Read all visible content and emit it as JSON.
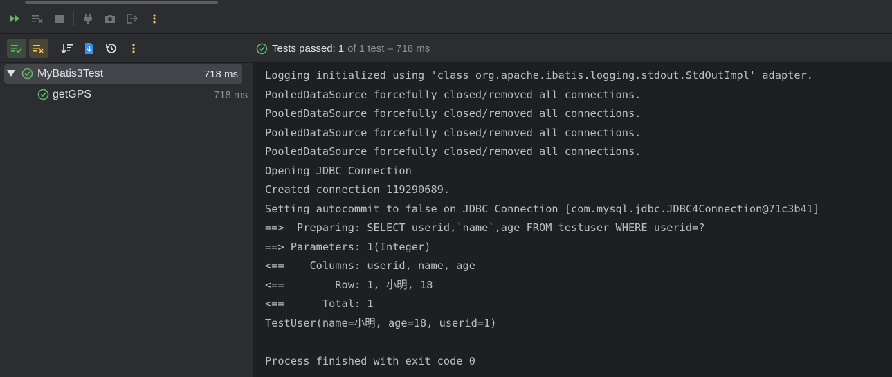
{
  "toolbar": {
    "rerun_label": "Rerun",
    "more_label": "More"
  },
  "status": {
    "passed_label": "Tests passed:",
    "passed_count": "1",
    "rest": "of 1 test – 718 ms"
  },
  "tree": {
    "items": [
      {
        "label": "MyBatis3Test",
        "time": "718 ms"
      },
      {
        "label": "getGPS",
        "time": "718 ms"
      }
    ]
  },
  "console": {
    "lines": [
      "Logging initialized using 'class org.apache.ibatis.logging.stdout.StdOutImpl' adapter.",
      "PooledDataSource forcefully closed/removed all connections.",
      "PooledDataSource forcefully closed/removed all connections.",
      "PooledDataSource forcefully closed/removed all connections.",
      "PooledDataSource forcefully closed/removed all connections.",
      "Opening JDBC Connection",
      "Created connection 119290689.",
      "Setting autocommit to false on JDBC Connection [com.mysql.jdbc.JDBC4Connection@71c3b41]",
      "==>  Preparing: SELECT userid,`name`,age FROM testuser WHERE userid=?",
      "==> Parameters: 1(Integer)",
      "<==    Columns: userid, name, age",
      "<==        Row: 1, 小明, 18",
      "<==      Total: 1",
      "TestUser(name=小明, age=18, userid=1)",
      "",
      "Process finished with exit code 0"
    ]
  },
  "colors": {
    "success": "#5fb865",
    "accent_yellow": "#f2c55c",
    "accent_blue": "#3592e6"
  }
}
